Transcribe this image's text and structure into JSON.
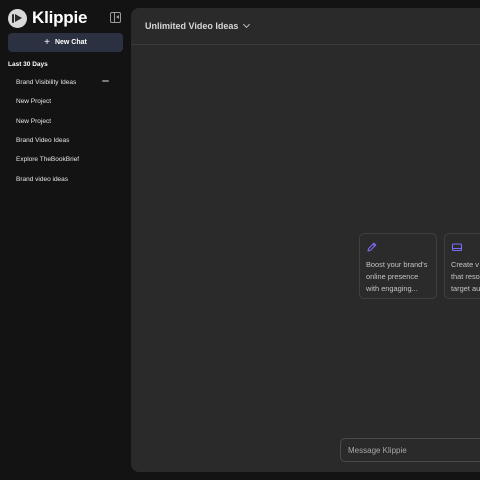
{
  "brand": {
    "name": "Klippie",
    "logo_icon": "play-logo-icon"
  },
  "sidebar": {
    "new_chat_label": "New Chat",
    "section_title": "Last 30 Days",
    "items": [
      {
        "label": "Brand Visibility Ideas",
        "has_menu": true
      },
      {
        "label": "New Project"
      },
      {
        "label": "New Project"
      },
      {
        "label": "Brand Video Ideas"
      },
      {
        "label": "Explore TheBookBrief"
      },
      {
        "label": "Brand video ideas"
      }
    ]
  },
  "header": {
    "model_label": "Unlimited Video Ideas"
  },
  "suggestions": [
    {
      "icon": "pencil-icon",
      "lines": [
        "Boost your brand's",
        "online presence",
        "with engaging..."
      ]
    },
    {
      "icon": "image-icon",
      "lines": [
        "Create v",
        "that reso",
        "target au"
      ]
    }
  ],
  "composer": {
    "placeholder": "Message Klippie"
  },
  "colors": {
    "accent": "#7b6cf6",
    "sidebar_bg": "#131313",
    "main_bg": "#2a2a2a",
    "new_chat_bg": "#2b3140"
  }
}
